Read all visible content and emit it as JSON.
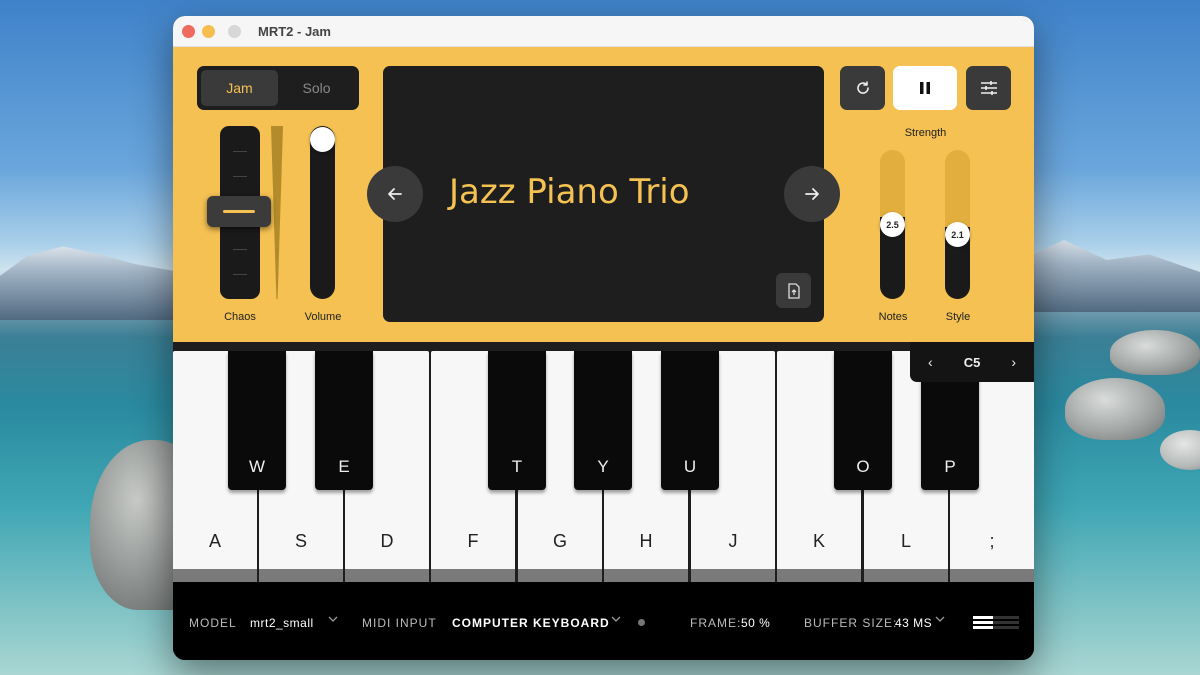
{
  "window": {
    "title": "MRT2 - Jam"
  },
  "mode_toggle": {
    "options": [
      "Jam",
      "Solo"
    ],
    "selected": "Jam"
  },
  "sliders": {
    "chaos": {
      "label": "Chaos",
      "level": 0.5
    },
    "volume": {
      "label": "Volume",
      "level": 1.0
    }
  },
  "display": {
    "preset_name": "Jazz Piano Trio"
  },
  "icons": {
    "refresh": "refresh-icon",
    "pause": "pause-icon",
    "settings": "sliders-icon",
    "prev": "arrow-left-icon",
    "next": "arrow-right-icon",
    "upload": "file-upload-icon"
  },
  "strength": {
    "title": "Strength",
    "notes": {
      "label": "Notes",
      "value": "2.5",
      "level": 0.55
    },
    "style": {
      "label": "Style",
      "value": "2.1",
      "level": 0.48
    }
  },
  "octave": {
    "label": "C5",
    "prev": "‹",
    "next": "›"
  },
  "keyboard": {
    "white_keys": [
      "A",
      "S",
      "D",
      "F",
      "G",
      "H",
      "J",
      "K",
      "L",
      ";"
    ],
    "black_keys": [
      "W",
      "E",
      "T",
      "Y",
      "U",
      "O",
      "P"
    ]
  },
  "bottom_bar": {
    "model_label": "MODEL",
    "model_value": "mrt2_small",
    "midi_label": "MIDI INPUT",
    "midi_value": "COMPUTER KEYBOARD",
    "frame_label": "FRAME:",
    "frame_value": "50 %",
    "buffer_label": "BUFFER SIZE:",
    "buffer_value": "43 MS"
  },
  "colors": {
    "accent": "#f4c152",
    "panel_dark": "#1e1e1e"
  }
}
